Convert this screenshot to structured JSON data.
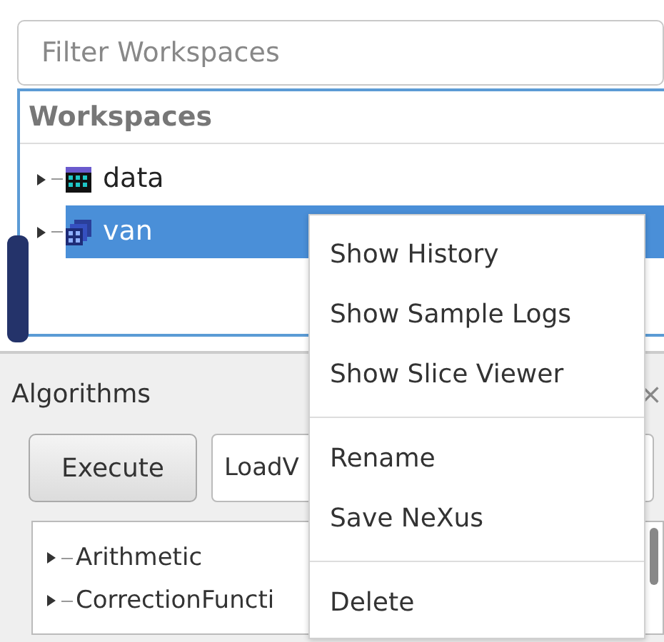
{
  "filter": {
    "placeholder": "Filter Workspaces"
  },
  "workspaces": {
    "title": "Workspaces",
    "items": [
      {
        "name": "data",
        "kind": "table",
        "selected": false,
        "expanded": false
      },
      {
        "name": "van",
        "kind": "group",
        "selected": true,
        "expanded": false
      }
    ]
  },
  "algorithms": {
    "title": "Algorithms",
    "close": "×",
    "execute": "Execute",
    "algorithm": "LoadV",
    "categories": [
      {
        "name": "Arithmetic",
        "expanded": false
      },
      {
        "name": "CorrectionFuncti",
        "expanded": false
      }
    ]
  },
  "context_menu": {
    "groups": [
      [
        "Show History",
        "Show Sample Logs",
        "Show Slice Viewer"
      ],
      [
        "Rename",
        "Save NeXus"
      ],
      [
        "Delete"
      ]
    ]
  }
}
